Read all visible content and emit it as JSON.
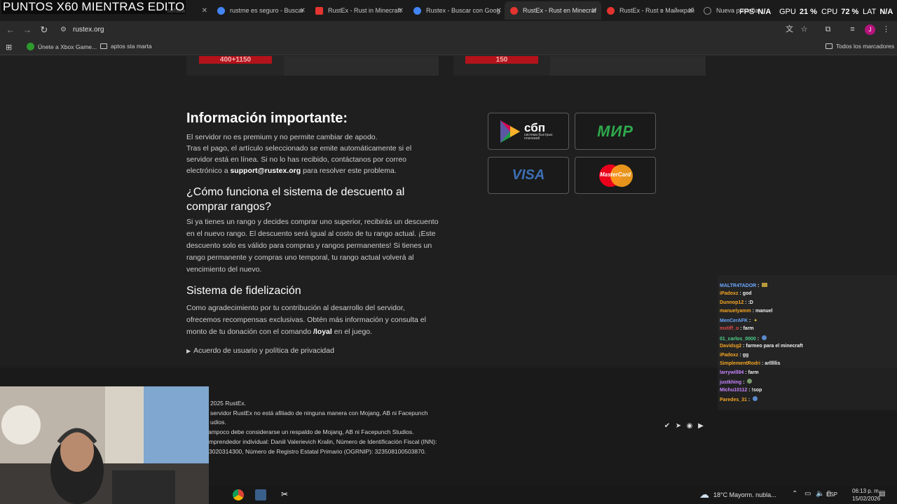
{
  "overlay": {
    "title": "PUNTOS X60 MIENTRAS EDITO"
  },
  "hud": {
    "fps_label": "FPS",
    "fps_value": "N/A",
    "gpu_label": "GPU",
    "gpu_value": "21 %",
    "cpu_label": "CPU",
    "cpu_value": "72 %",
    "lat_label": "LAT",
    "lat_value": "N/A"
  },
  "tabs": [
    {
      "label": "softwa",
      "favicon_color": "#4a4a4a"
    },
    {
      "label": "rustme es seguro - Buscar",
      "favicon_color": "#4285f4"
    },
    {
      "label": "RustEx - Rust in Minecraft",
      "favicon_color": "#e3342f"
    },
    {
      "label": "Rustex - Buscar con Goog",
      "favicon_color": "#4285f4"
    },
    {
      "label": "RustEx - Rust en Minecraf",
      "favicon_color": "#e3342f"
    },
    {
      "label": "RustEx - Rust в Майнкрай",
      "favicon_color": "#e3342f"
    },
    {
      "label": "Nueva pestaña",
      "favicon_color": "#888888"
    }
  ],
  "address_bar": {
    "url": "rustex.org"
  },
  "bookmarks": {
    "items": [
      "Únete a Xbox Game...",
      "aptos sta marta"
    ],
    "all_label": "Todos los marcadores"
  },
  "page": {
    "top_cards": {
      "left_price": "400+1150",
      "right_price": "150"
    },
    "info_title": "Información importante:",
    "info_text_1": "El servidor no es premium y no permite cambiar de apodo.",
    "info_text_2": "Tras el pago, el artículo seleccionado se emite automáticamente si el servidor está en línea. Si no lo has recibido, contáctanos por correo electrónico a",
    "info_email": "support@rustex.org",
    "info_text_3": "para resolver este problema.",
    "discount_title": "¿Cómo funciona el sistema de descuento al comprar rangos?",
    "discount_text": "Si ya tienes un rango y decides comprar uno superior, recibirás un descuento en el nuevo rango. El descuento será igual al costo de tu rango actual. ¡Este descuento solo es válido para compras y rangos permanentes! Si tienes un rango permanente y compras uno temporal, tu rango actual volverá al vencimiento del nuevo.",
    "loyalty_title": "Sistema de fidelización",
    "loyalty_text_1": "Como agradecimiento por tu contribución al desarrollo del servidor, ofrecemos recompensas exclusivas. Obtén más información y consulta el monto de tu donación con el comando",
    "loyalty_command": "/loyal",
    "loyalty_text_2": "en el juego.",
    "agreement_label": "Acuerdo de usuario y política de privacidad",
    "payments": {
      "sbp_main": "сбп",
      "sbp_sub": "система быстрых платежей",
      "mir": "МИР",
      "visa": "VISA",
      "mastercard": "MasterCard"
    }
  },
  "footer": {
    "copyright": "2025 RustEx.",
    "disclaimer_1": "servidor RustEx no está afiliado de ninguna manera con Mojang, AB ni Facepunch",
    "disclaimer_2": "udios.",
    "disclaimer_3": "ampoco debe considerarse un respaldo de Mojang, AB ni Facepunch Studios.",
    "disclaimer_4": "mprendedor individual: Daniil Valerievich Kralin, Número de Identificación Fiscal (INN):",
    "disclaimer_5": "3020314300, Número de Registro Estatal Primario (OGRNIP): 323508100503870."
  },
  "chat": [
    {
      "user": "MALTR4TADOR",
      "msg": "",
      "color": "#6aa8ff"
    },
    {
      "user": "iPadoxz",
      "msg": "god",
      "color": "#f5a623"
    },
    {
      "user": "Dunnop12",
      "msg": ":D",
      "color": "#f5a623"
    },
    {
      "user": "manuelyamm",
      "msg": "manuel",
      "color": "#f5a623"
    },
    {
      "user": "MenCerAFK",
      "msg": "",
      "color": "#6aa8ff"
    },
    {
      "user": "mxtiff_o",
      "msg": "farm",
      "color": "#e34b4b"
    },
    {
      "user": "01_carlos_0000",
      "msg": "",
      "color": "#4bd18a"
    },
    {
      "user": "Davidsg2",
      "msg": "farmeo para el minecraft",
      "color": "#f5a623"
    },
    {
      "user": "iPadoxz",
      "msg": "gg",
      "color": "#f5a623"
    },
    {
      "user": "SimplementRodri",
      "msg": "arlllllis",
      "color": "#f5a623"
    },
    {
      "user": "larrywill84",
      "msg": "farm",
      "color": "#c884ff"
    },
    {
      "user": "justkhing",
      "msg": "",
      "color": "#c884ff"
    },
    {
      "user": "Michu10112",
      "msg": "!sop",
      "color": "#c884ff"
    },
    {
      "user": "Paredes_31",
      "msg": "",
      "color": "#f5a623"
    }
  ],
  "taskbar": {
    "weather": "18°C  Mayorm. nubla...",
    "lang": "ESP",
    "time": "06:13 p. m.",
    "date": "15/02/2026"
  }
}
